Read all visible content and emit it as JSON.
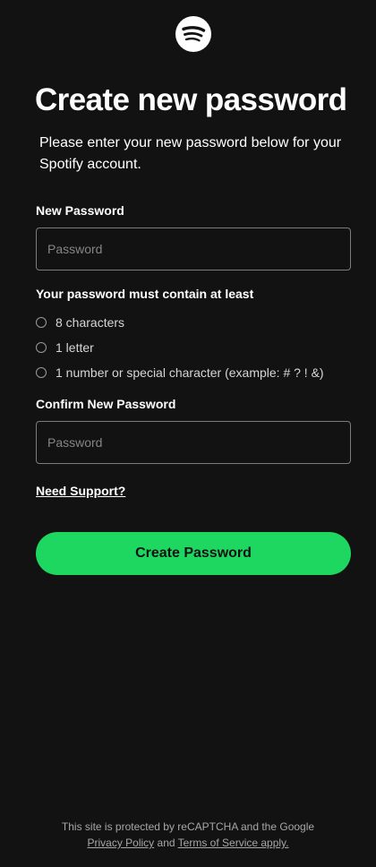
{
  "brand": {
    "logo_icon": "spotify-logo-icon",
    "logo_bg": "#ffffff",
    "logo_fg": "#121212"
  },
  "header": {
    "title": "Create new password",
    "subtitle": "Please enter your new password below for your Spotify account."
  },
  "form": {
    "new_password": {
      "label": "New Password",
      "placeholder": "Password",
      "value": ""
    },
    "requirements": {
      "heading": "Your password must contain at least",
      "items": [
        {
          "label": "8 characters",
          "met": false
        },
        {
          "label": "1 letter",
          "met": false
        },
        {
          "label": "1 number or special character (example: # ? ! &)",
          "met": false
        }
      ]
    },
    "confirm_password": {
      "label": "Confirm New Password",
      "placeholder": "Password",
      "value": ""
    },
    "support_link": "Need Support?",
    "submit_label": "Create Password"
  },
  "footer": {
    "notice": "This site is protected by reCAPTCHA and the Google",
    "privacy_link": "Privacy Policy",
    "and_text": "and",
    "terms_link": "Terms of Service apply."
  },
  "colors": {
    "background": "#121212",
    "accent": "#1ed760",
    "input_border": "#7c7c7c",
    "muted_text": "#a7a7a7"
  }
}
